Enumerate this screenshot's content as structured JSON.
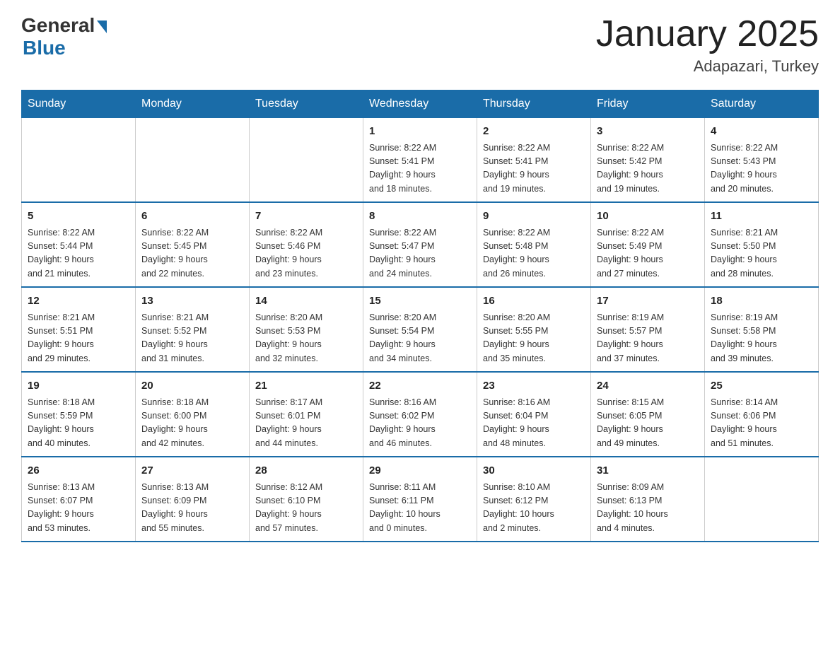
{
  "header": {
    "logo_general": "General",
    "logo_blue": "Blue",
    "title": "January 2025",
    "subtitle": "Adapazari, Turkey"
  },
  "weekdays": [
    "Sunday",
    "Monday",
    "Tuesday",
    "Wednesday",
    "Thursday",
    "Friday",
    "Saturday"
  ],
  "weeks": [
    [
      {
        "day": "",
        "info": ""
      },
      {
        "day": "",
        "info": ""
      },
      {
        "day": "",
        "info": ""
      },
      {
        "day": "1",
        "info": "Sunrise: 8:22 AM\nSunset: 5:41 PM\nDaylight: 9 hours\nand 18 minutes."
      },
      {
        "day": "2",
        "info": "Sunrise: 8:22 AM\nSunset: 5:41 PM\nDaylight: 9 hours\nand 19 minutes."
      },
      {
        "day": "3",
        "info": "Sunrise: 8:22 AM\nSunset: 5:42 PM\nDaylight: 9 hours\nand 19 minutes."
      },
      {
        "day": "4",
        "info": "Sunrise: 8:22 AM\nSunset: 5:43 PM\nDaylight: 9 hours\nand 20 minutes."
      }
    ],
    [
      {
        "day": "5",
        "info": "Sunrise: 8:22 AM\nSunset: 5:44 PM\nDaylight: 9 hours\nand 21 minutes."
      },
      {
        "day": "6",
        "info": "Sunrise: 8:22 AM\nSunset: 5:45 PM\nDaylight: 9 hours\nand 22 minutes."
      },
      {
        "day": "7",
        "info": "Sunrise: 8:22 AM\nSunset: 5:46 PM\nDaylight: 9 hours\nand 23 minutes."
      },
      {
        "day": "8",
        "info": "Sunrise: 8:22 AM\nSunset: 5:47 PM\nDaylight: 9 hours\nand 24 minutes."
      },
      {
        "day": "9",
        "info": "Sunrise: 8:22 AM\nSunset: 5:48 PM\nDaylight: 9 hours\nand 26 minutes."
      },
      {
        "day": "10",
        "info": "Sunrise: 8:22 AM\nSunset: 5:49 PM\nDaylight: 9 hours\nand 27 minutes."
      },
      {
        "day": "11",
        "info": "Sunrise: 8:21 AM\nSunset: 5:50 PM\nDaylight: 9 hours\nand 28 minutes."
      }
    ],
    [
      {
        "day": "12",
        "info": "Sunrise: 8:21 AM\nSunset: 5:51 PM\nDaylight: 9 hours\nand 29 minutes."
      },
      {
        "day": "13",
        "info": "Sunrise: 8:21 AM\nSunset: 5:52 PM\nDaylight: 9 hours\nand 31 minutes."
      },
      {
        "day": "14",
        "info": "Sunrise: 8:20 AM\nSunset: 5:53 PM\nDaylight: 9 hours\nand 32 minutes."
      },
      {
        "day": "15",
        "info": "Sunrise: 8:20 AM\nSunset: 5:54 PM\nDaylight: 9 hours\nand 34 minutes."
      },
      {
        "day": "16",
        "info": "Sunrise: 8:20 AM\nSunset: 5:55 PM\nDaylight: 9 hours\nand 35 minutes."
      },
      {
        "day": "17",
        "info": "Sunrise: 8:19 AM\nSunset: 5:57 PM\nDaylight: 9 hours\nand 37 minutes."
      },
      {
        "day": "18",
        "info": "Sunrise: 8:19 AM\nSunset: 5:58 PM\nDaylight: 9 hours\nand 39 minutes."
      }
    ],
    [
      {
        "day": "19",
        "info": "Sunrise: 8:18 AM\nSunset: 5:59 PM\nDaylight: 9 hours\nand 40 minutes."
      },
      {
        "day": "20",
        "info": "Sunrise: 8:18 AM\nSunset: 6:00 PM\nDaylight: 9 hours\nand 42 minutes."
      },
      {
        "day": "21",
        "info": "Sunrise: 8:17 AM\nSunset: 6:01 PM\nDaylight: 9 hours\nand 44 minutes."
      },
      {
        "day": "22",
        "info": "Sunrise: 8:16 AM\nSunset: 6:02 PM\nDaylight: 9 hours\nand 46 minutes."
      },
      {
        "day": "23",
        "info": "Sunrise: 8:16 AM\nSunset: 6:04 PM\nDaylight: 9 hours\nand 48 minutes."
      },
      {
        "day": "24",
        "info": "Sunrise: 8:15 AM\nSunset: 6:05 PM\nDaylight: 9 hours\nand 49 minutes."
      },
      {
        "day": "25",
        "info": "Sunrise: 8:14 AM\nSunset: 6:06 PM\nDaylight: 9 hours\nand 51 minutes."
      }
    ],
    [
      {
        "day": "26",
        "info": "Sunrise: 8:13 AM\nSunset: 6:07 PM\nDaylight: 9 hours\nand 53 minutes."
      },
      {
        "day": "27",
        "info": "Sunrise: 8:13 AM\nSunset: 6:09 PM\nDaylight: 9 hours\nand 55 minutes."
      },
      {
        "day": "28",
        "info": "Sunrise: 8:12 AM\nSunset: 6:10 PM\nDaylight: 9 hours\nand 57 minutes."
      },
      {
        "day": "29",
        "info": "Sunrise: 8:11 AM\nSunset: 6:11 PM\nDaylight: 10 hours\nand 0 minutes."
      },
      {
        "day": "30",
        "info": "Sunrise: 8:10 AM\nSunset: 6:12 PM\nDaylight: 10 hours\nand 2 minutes."
      },
      {
        "day": "31",
        "info": "Sunrise: 8:09 AM\nSunset: 6:13 PM\nDaylight: 10 hours\nand 4 minutes."
      },
      {
        "day": "",
        "info": ""
      }
    ]
  ]
}
